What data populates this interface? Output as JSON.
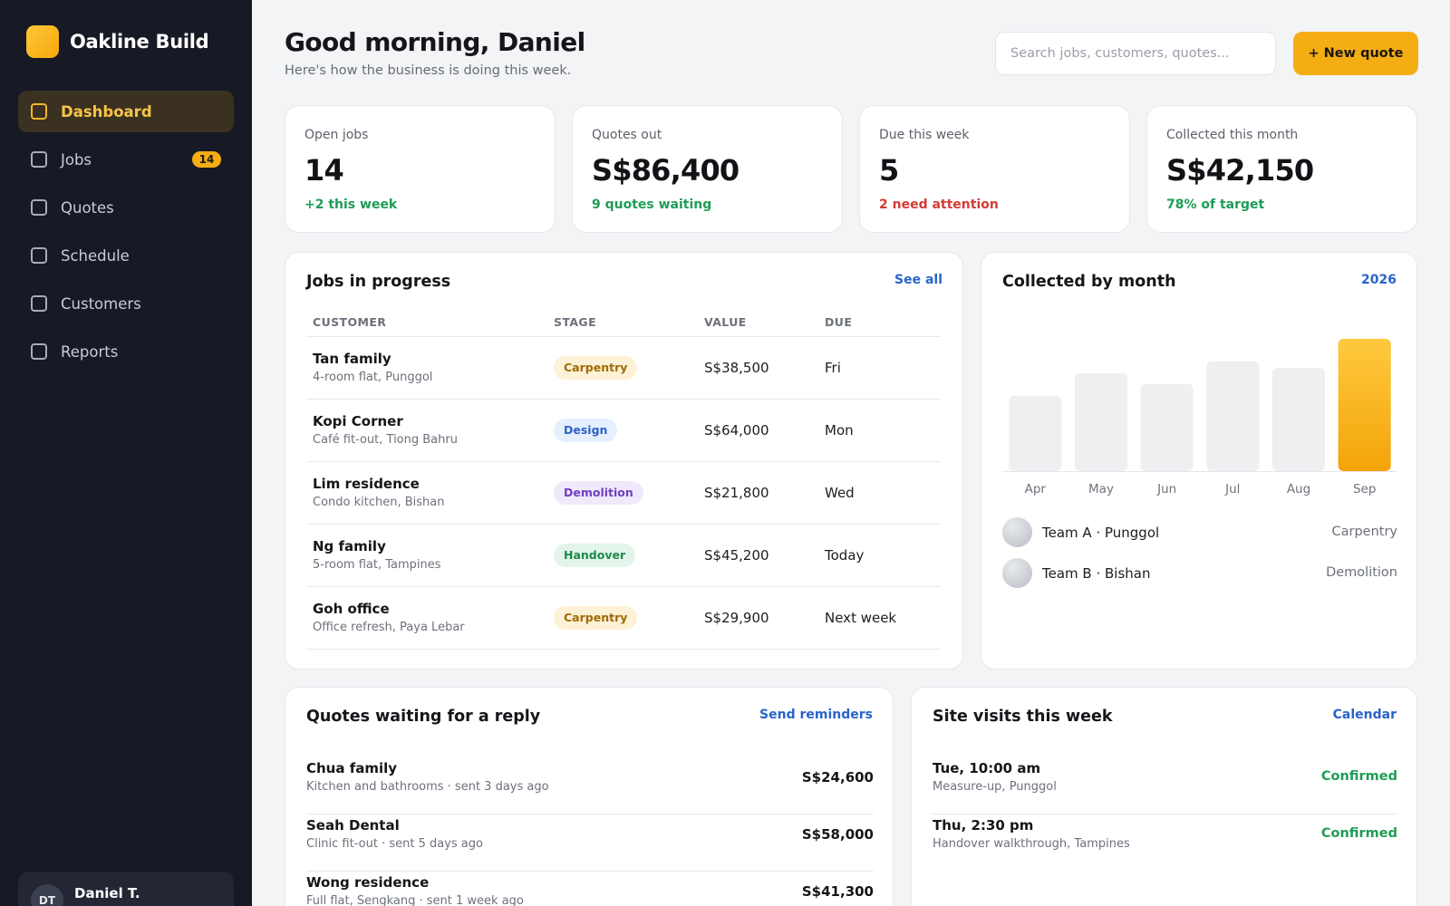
{
  "brand": {
    "name": "Oakline Build"
  },
  "sidebar": {
    "items": [
      {
        "label": "Dashboard",
        "active": true
      },
      {
        "label": "Jobs",
        "badge": "14"
      },
      {
        "label": "Quotes"
      },
      {
        "label": "Schedule"
      },
      {
        "label": "Customers"
      },
      {
        "label": "Reports"
      }
    ],
    "user": {
      "initials": "DT",
      "name": "Daniel T."
    }
  },
  "header": {
    "greeting": "Good morning, Daniel",
    "subtitle": "Here's how the business is doing this week.",
    "search_placeholder": "Search jobs, customers, quotes...",
    "new_quote_label": "+ New quote"
  },
  "stats": [
    {
      "label": "Open jobs",
      "value": "14",
      "note": "+2 this week",
      "tone": "green"
    },
    {
      "label": "Quotes out",
      "value": "S$86,400",
      "note": "9 quotes waiting",
      "tone": "green"
    },
    {
      "label": "Due this week",
      "value": "5",
      "note": "2 need attention",
      "tone": "red"
    },
    {
      "label": "Collected this month",
      "value": "S$42,150",
      "note": "78% of target",
      "tone": "green"
    }
  ],
  "jobs": {
    "title": "Jobs in progress",
    "link": "See all",
    "columns": [
      "CUSTOMER",
      "STAGE",
      "VALUE",
      "DUE"
    ],
    "rows": [
      {
        "customer": "Tan family",
        "detail": "4-room flat, Punggol",
        "stage": "Carpentry",
        "value": "S$38,500",
        "due": "Fri"
      },
      {
        "customer": "Kopi Corner",
        "detail": "Café fit-out, Tiong Bahru",
        "stage": "Design",
        "value": "S$64,000",
        "due": "Mon"
      },
      {
        "customer": "Lim residence",
        "detail": "Condo kitchen, Bishan",
        "stage": "Demolition",
        "value": "S$21,800",
        "due": "Wed"
      },
      {
        "customer": "Ng family",
        "detail": "5-room flat, Tampines",
        "stage": "Handover",
        "value": "S$45,200",
        "due": "Today"
      },
      {
        "customer": "Goh office",
        "detail": "Office refresh, Paya Lebar",
        "stage": "Carpentry",
        "value": "S$29,900",
        "due": "Next week"
      }
    ]
  },
  "collected": {
    "title": "Collected by month",
    "year_label": "2026",
    "teams": [
      {
        "name": "Team A · Punggol",
        "role": "Carpentry"
      },
      {
        "name": "Team B · Bishan",
        "role": "Demolition"
      }
    ]
  },
  "chart_data": {
    "type": "bar",
    "categories": [
      "Apr",
      "May",
      "Jun",
      "Jul",
      "Aug",
      "Sep"
    ],
    "values": [
      0.57,
      0.74,
      0.66,
      0.83,
      0.78,
      1.0
    ],
    "highlight_index": 5,
    "ylim": [
      0,
      1
    ],
    "grid": false,
    "colors": {
      "bar": "#efeff1",
      "highlight_top": "#ffc93e",
      "highlight_bottom": "#f3a409"
    }
  },
  "quotes_waiting": {
    "title": "Quotes waiting for a reply",
    "link": "Send reminders",
    "items": [
      {
        "name": "Chua family",
        "detail": "Kitchen and bathrooms · sent 3 days ago",
        "amount": "S$24,600"
      },
      {
        "name": "Seah Dental",
        "detail": "Clinic fit-out · sent 5 days ago",
        "amount": "S$58,000"
      },
      {
        "name": "Wong residence",
        "detail": "Full flat, Sengkang · sent 1 week ago",
        "amount": "S$41,300"
      }
    ]
  },
  "site_visits": {
    "title": "Site visits this week",
    "link": "Calendar",
    "items": [
      {
        "time": "Tue, 10:00 am",
        "detail": "Measure-up, Punggol",
        "status": "Confirmed"
      },
      {
        "time": "Thu, 2:30 pm",
        "detail": "Handover walkthrough, Tampines",
        "status": "Confirmed"
      }
    ]
  }
}
